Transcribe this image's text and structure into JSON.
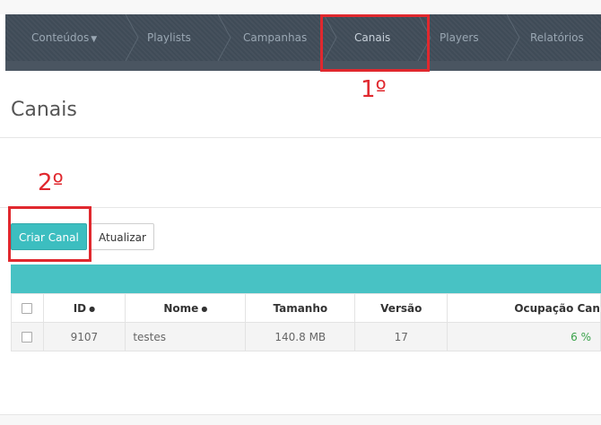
{
  "nav": {
    "items": [
      {
        "label": "Conteúdos",
        "has_dropdown": true
      },
      {
        "label": "Playlists"
      },
      {
        "label": "Campanhas"
      },
      {
        "label": "Canais",
        "active": true
      },
      {
        "label": "Players"
      },
      {
        "label": "Relatórios"
      }
    ]
  },
  "annotations": {
    "step1": "1º",
    "step2": "2º",
    "color": "#e0282e"
  },
  "page": {
    "title": "Canais"
  },
  "toolbar": {
    "create_label": "Criar Canal",
    "refresh_label": "Atualizar"
  },
  "table": {
    "columns": [
      "ID",
      "Nome",
      "Tamanho",
      "Versão",
      "Ocupação Can"
    ],
    "rows": [
      {
        "id": "9107",
        "nome": "testes",
        "tamanho": "140.8 MB",
        "versao": "17",
        "ocupacao": "6 %"
      }
    ]
  },
  "colors": {
    "navbar": "#3f4b57",
    "accent": "#3cbec0",
    "table_banner": "#48c2c4",
    "ok": "#3aa24a"
  }
}
